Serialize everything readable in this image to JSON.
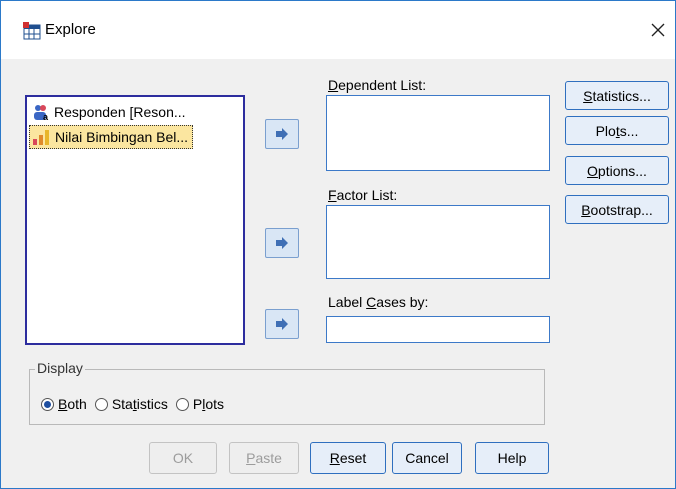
{
  "window": {
    "title": "Explore"
  },
  "variables": [
    {
      "label": "Responden [Reson...",
      "icon": "nominal-string-variable-icon",
      "selected": false
    },
    {
      "label": "Nilai Bimbingan Bel...",
      "icon": "scale-variable-icon",
      "selected": true
    }
  ],
  "dependent_list": {
    "label_pre": "",
    "label_key": "D",
    "label_post": "ependent List:"
  },
  "factor_list": {
    "label_pre": "",
    "label_key": "F",
    "label_post": "actor List:"
  },
  "label_cases": {
    "label_pre": "Label ",
    "label_key": "C",
    "label_post": "ases by:",
    "value": ""
  },
  "side_buttons": {
    "statistics": {
      "pre": "",
      "key": "S",
      "post": "tatistics..."
    },
    "plots": {
      "pre": "Plo",
      "key": "t",
      "post": "s..."
    },
    "options": {
      "pre": "",
      "key": "O",
      "post": "ptions..."
    },
    "bootstrap": {
      "pre": "",
      "key": "B",
      "post": "ootstrap..."
    }
  },
  "display": {
    "legend": "Display",
    "options": [
      {
        "pre": "",
        "key": "B",
        "post": "oth",
        "checked": true
      },
      {
        "pre": "Sta",
        "key": "t",
        "post": "istics",
        "checked": false
      },
      {
        "pre": "P",
        "key": "l",
        "post": "ots",
        "checked": false
      }
    ]
  },
  "bottom_buttons": {
    "ok": {
      "label": "OK",
      "enabled": false
    },
    "paste": {
      "pre": "",
      "key": "P",
      "post": "aste",
      "enabled": false
    },
    "reset": {
      "pre": "",
      "key": "R",
      "post": "eset",
      "enabled": true
    },
    "cancel": {
      "label": "Cancel",
      "enabled": true
    },
    "help": {
      "label": "Help",
      "enabled": true
    }
  },
  "colors": {
    "accent": "#2f6fbf",
    "selection": "#fbe6a0",
    "arrow": "#4a7fc0"
  }
}
